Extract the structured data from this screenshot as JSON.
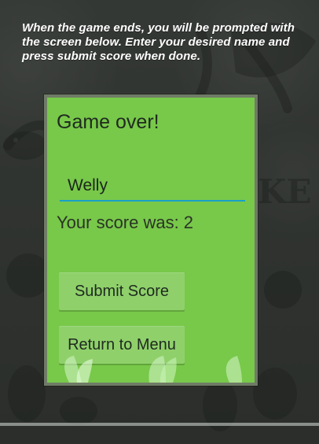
{
  "instruction": {
    "text": "When  the game ends, you will be prompted with the screen below. Enter your desired name and press submit score when done."
  },
  "dialog": {
    "title": "Game over!",
    "name_input_value": "Welly",
    "score_label": "Your score was:",
    "score_value": "2",
    "submit_button": "Submit Score",
    "menu_button": "Return to Menu"
  },
  "background": {
    "logo_fragment_text": "KE"
  },
  "colors": {
    "dialog_bg": "#78c84a",
    "button_bg": "#8fd06b",
    "text": "#1f2a1f",
    "input_underline": "#18a0c8",
    "instruction_text": "#ffffff"
  }
}
